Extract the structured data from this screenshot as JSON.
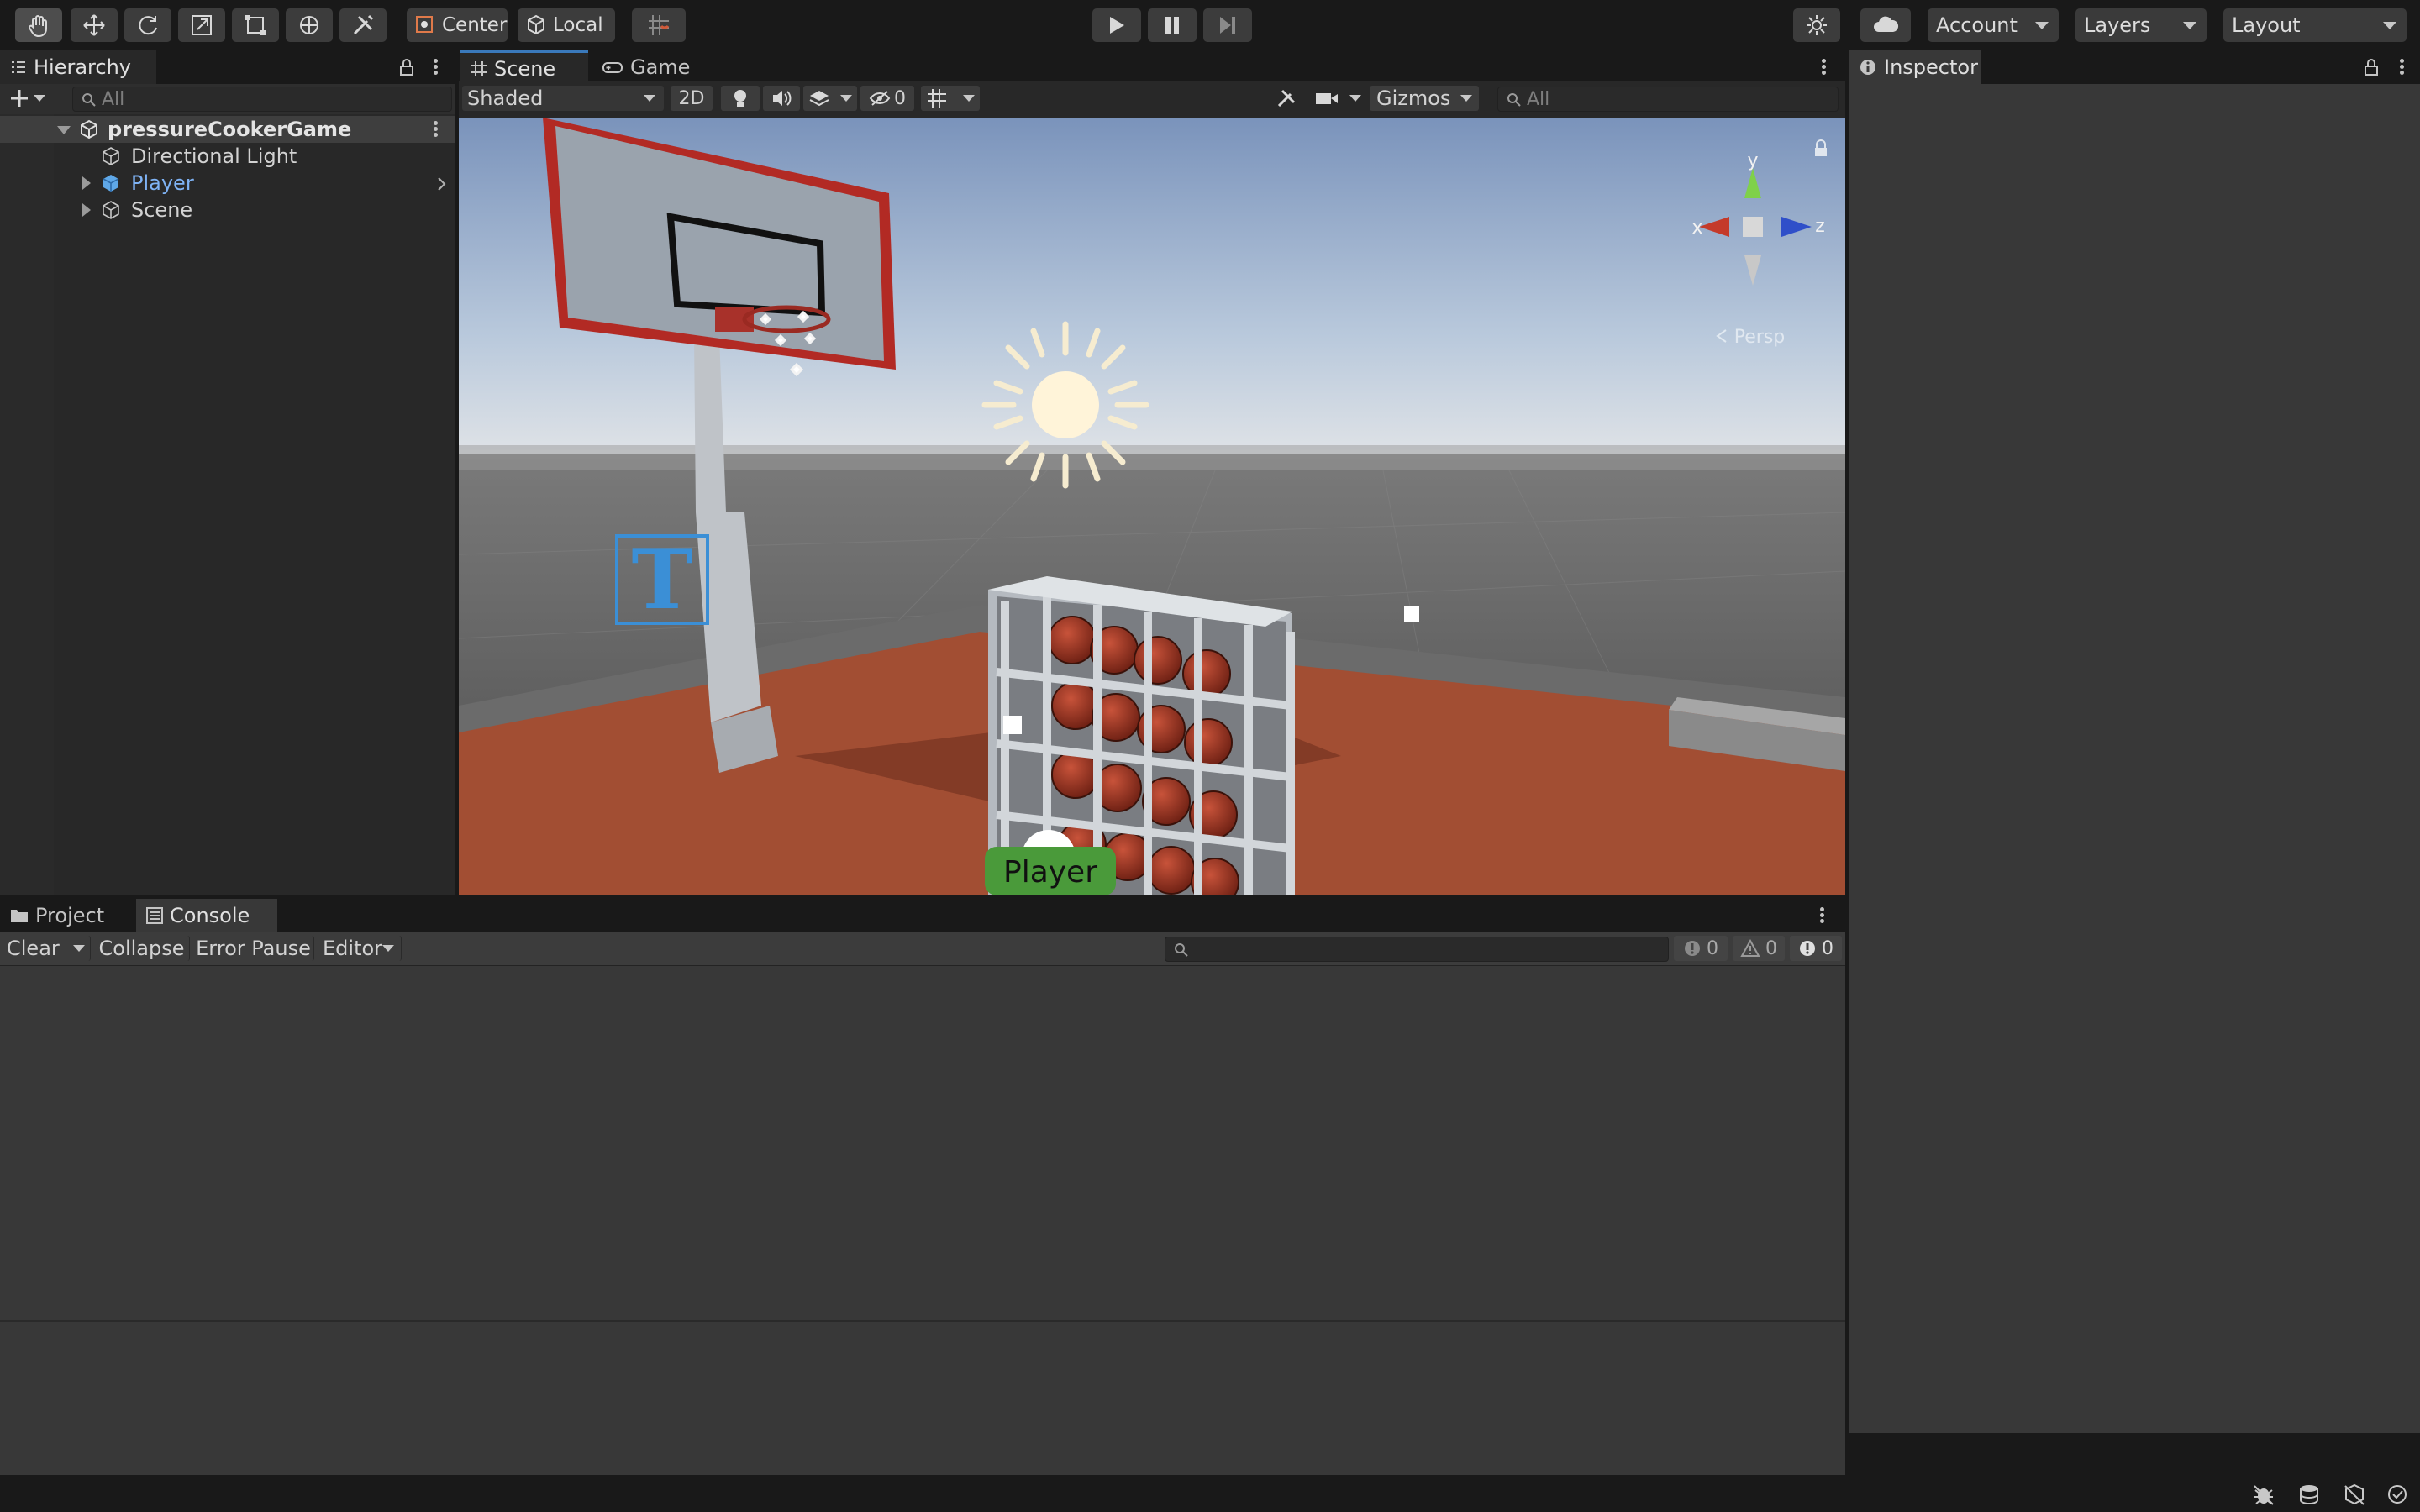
{
  "toolbar": {
    "pivot_label": "Center",
    "space_label": "Local",
    "account_label": "Account",
    "layers_label": "Layers",
    "layout_label": "Layout"
  },
  "hierarchy": {
    "tab_label": "Hierarchy",
    "search_placeholder": "All",
    "scene_name": "pressureCookerGame",
    "items": [
      {
        "label": "Directional Light"
      },
      {
        "label": "Player"
      },
      {
        "label": "Scene"
      }
    ]
  },
  "scene_view": {
    "tabs": [
      {
        "label": "Scene"
      },
      {
        "label": "Game"
      }
    ],
    "draw_mode": "Shaded",
    "mode_2d": "2D",
    "hidden_count": "0",
    "gizmos_label": "Gizmos",
    "search_placeholder": "All",
    "axis_x": "x",
    "axis_y": "y",
    "axis_z": "z",
    "projection_label": "Persp",
    "player_label": "Player",
    "text_gizmo": "T"
  },
  "inspector": {
    "tab_label": "Inspector"
  },
  "console": {
    "tabs": [
      {
        "label": "Project"
      },
      {
        "label": "Console"
      }
    ],
    "clear_label": "Clear",
    "collapse_label": "Collapse",
    "error_pause_label": "Error Pause",
    "editor_label": "Editor",
    "log_count": "0",
    "warn_count": "0",
    "error_count": "0"
  },
  "colors": {
    "accent": "#3a79bb",
    "player_text": "#7fb3f5",
    "window_bg": "#191919",
    "panel_bg": "#383838"
  }
}
